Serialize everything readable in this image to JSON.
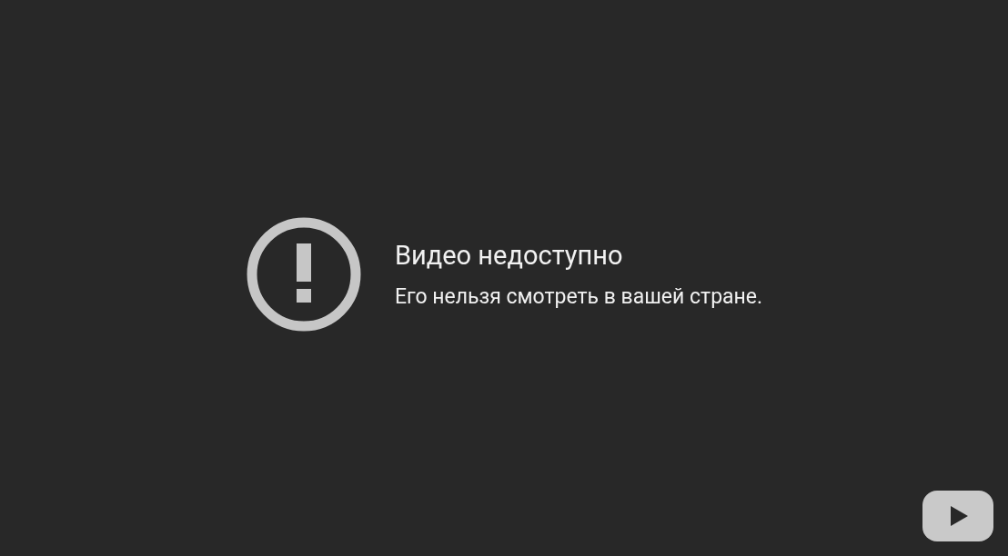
{
  "error": {
    "title": "Видео недоступно",
    "message": "Его нельзя смотреть в вашей стране."
  }
}
